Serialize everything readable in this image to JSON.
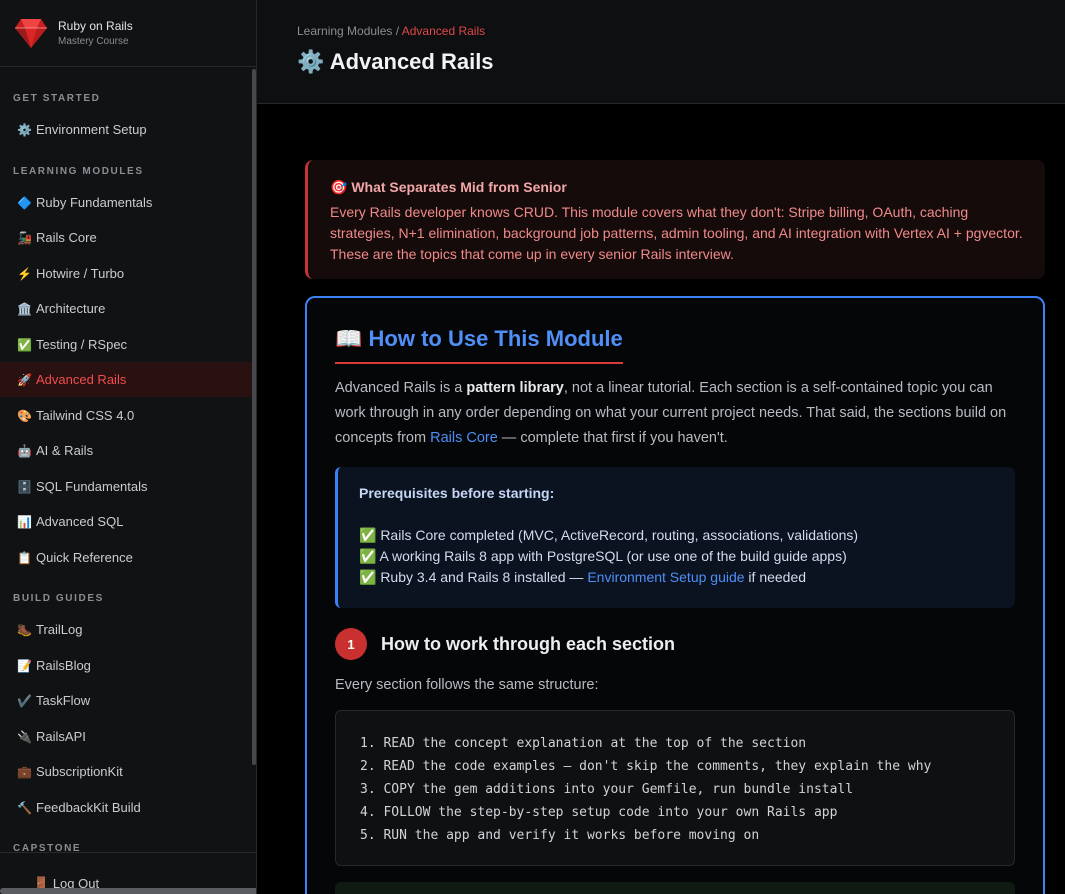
{
  "brand": {
    "title": "Ruby on Rails",
    "subtitle": "Mastery Course"
  },
  "sidebar": {
    "sections": {
      "get_started": "GET STARTED",
      "learning_modules": "LEARNING MODULES",
      "build_guides": "BUILD GUIDES",
      "capstone": "CAPSTONE"
    },
    "items": [
      {
        "emoji": "⚙️",
        "label": "Environment Setup"
      },
      {
        "emoji": "🔷",
        "label": "Ruby Fundamentals"
      },
      {
        "emoji": "🚂",
        "label": "Rails Core"
      },
      {
        "emoji": "⚡",
        "label": "Hotwire / Turbo"
      },
      {
        "emoji": "🏛️",
        "label": "Architecture"
      },
      {
        "emoji": "✅",
        "label": "Testing / RSpec"
      },
      {
        "emoji": "🚀",
        "label": "Advanced Rails"
      },
      {
        "emoji": "🎨",
        "label": "Tailwind CSS 4.0"
      },
      {
        "emoji": "🤖",
        "label": "AI & Rails"
      },
      {
        "emoji": "🗄️",
        "label": "SQL Fundamentals"
      },
      {
        "emoji": "📊",
        "label": "Advanced SQL"
      },
      {
        "emoji": "📋",
        "label": "Quick Reference"
      },
      {
        "emoji": "🥾",
        "label": "TrailLog"
      },
      {
        "emoji": "📝",
        "label": "RailsBlog"
      },
      {
        "emoji": "✔️",
        "label": "TaskFlow"
      },
      {
        "emoji": "🔌",
        "label": "RailsAPI"
      },
      {
        "emoji": "💼",
        "label": "SubscriptionKit"
      },
      {
        "emoji": "🔨",
        "label": "FeedbackKit Build"
      }
    ],
    "logout": {
      "emoji": "🚪",
      "label": "Log Out"
    }
  },
  "header": {
    "breadcrumb_parent": "Learning Modules",
    "breadcrumb_sep": " / ",
    "breadcrumb_current": "Advanced Rails",
    "title_emoji": "⚙️",
    "title": "Advanced Rails"
  },
  "callout": {
    "head": "🎯 What Separates Mid from Senior",
    "body": "Every Rails developer knows CRUD. This module covers what they don't: Stripe billing, OAuth, caching strategies, N+1 elimination, background job patterns, admin tooling, and AI integration with Vertex AI + pgvector. These are the topics that come up in every senior Rails interview."
  },
  "module": {
    "title_emoji": "📖",
    "title": "How to Use This Module",
    "intro_1": "Advanced Rails is a ",
    "intro_bold": "pattern library",
    "intro_2": ", not a linear tutorial. Each section is a self-contained topic you can work through in any order depending on what your current project needs. That said, the sections build on concepts from ",
    "intro_link": "Rails Core",
    "intro_3": " — complete that first if you haven't.",
    "prereq_head": "Prerequisites before starting:",
    "prereq_1": "✅ Rails Core completed (MVC, ActiveRecord, routing, associations, validations)",
    "prereq_2": "✅ A working Rails 8 app with PostgreSQL (or use one of the build guide apps)",
    "prereq_3a": "✅ Ruby 3.4 and Rails 8 installed — ",
    "prereq_3_link": "Environment Setup guide",
    "prereq_3b": " if needed",
    "step_number": "1",
    "step_title": "How to work through each section",
    "step_text": "Every section follows the same structure:",
    "code_lines": [
      "1. READ the concept explanation at the top of the section",
      "2. READ the code examples — don't skip the comments, they explain the why",
      "3. COPY the gem additions into your Gemfile, run bundle install",
      "4. FOLLOW the step-by-step setup code into your own Rails app",
      "5. RUN the app and verify it works before moving on"
    ]
  },
  "colors": {
    "accent_red": "#e04848",
    "accent_blue": "#3b82f6",
    "background": "#000000"
  }
}
